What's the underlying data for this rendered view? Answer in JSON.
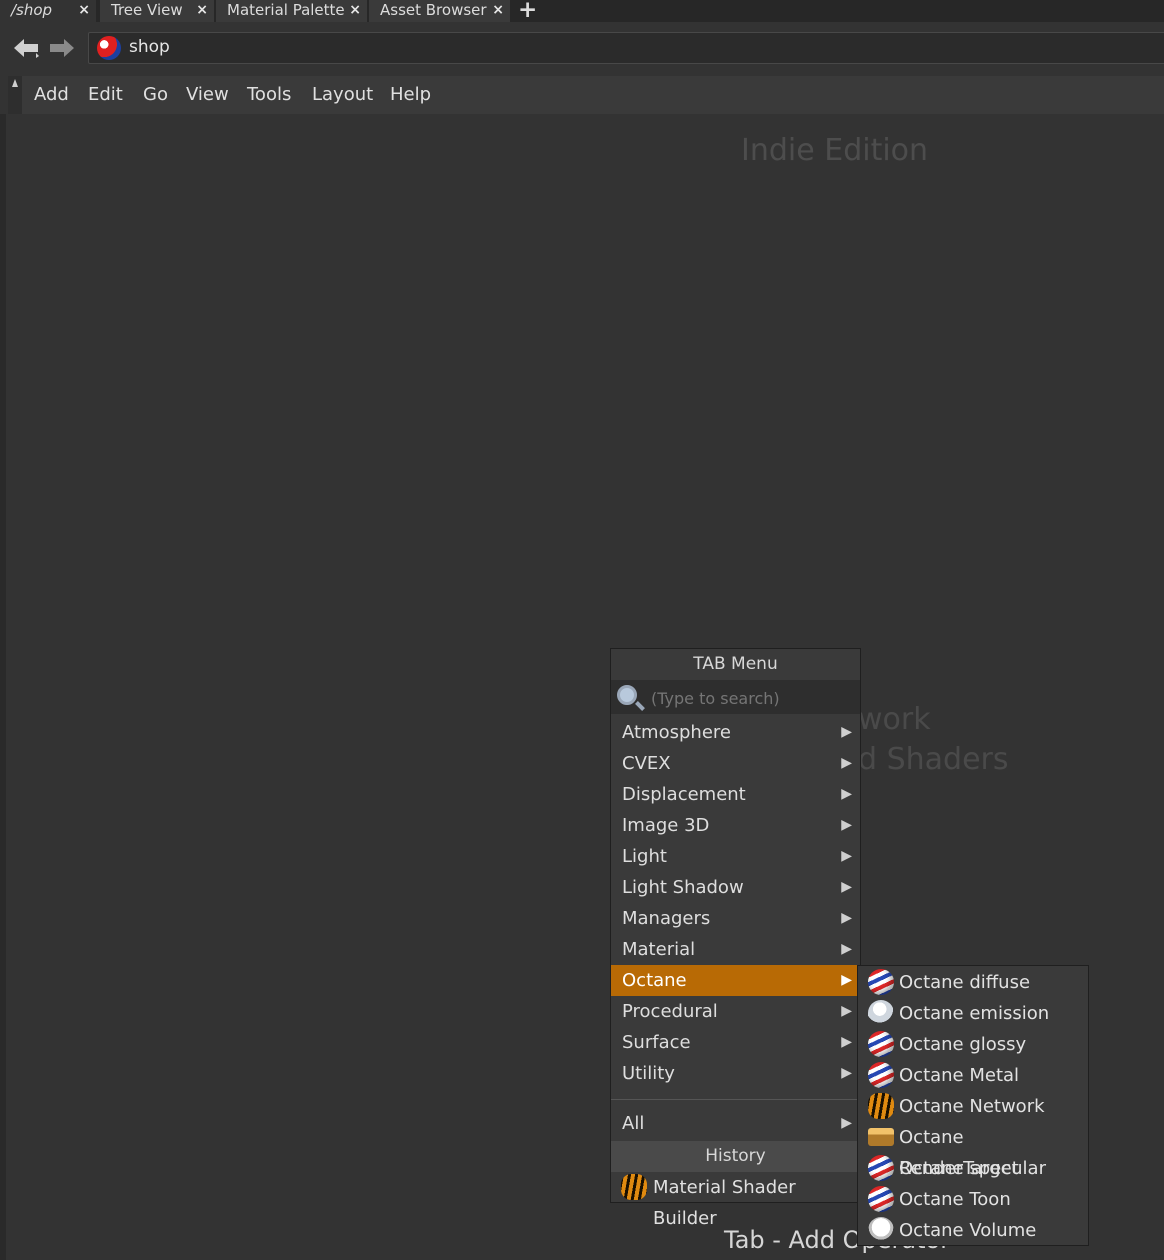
{
  "tabs": [
    {
      "label": "/shop",
      "active": true
    },
    {
      "label": "Tree View",
      "active": false
    },
    {
      "label": "Material Palette",
      "active": false
    },
    {
      "label": "Asset Browser",
      "active": false
    }
  ],
  "tab_close_glyph": "×",
  "tab_add_glyph": "+",
  "path": {
    "value": "shop",
    "icon": "shop-context-icon"
  },
  "menubar": [
    "Add",
    "Edit",
    "Go",
    "View",
    "Tools",
    "Layout",
    "Help"
  ],
  "canvas": {
    "edition": "Indie Edition",
    "bg_line1": "work",
    "bg_line2": "d Shaders",
    "footer": "Tab - Add Operator"
  },
  "tab_menu": {
    "title": "TAB Menu",
    "search_placeholder": "(Type to search)",
    "categories": [
      "Atmosphere",
      "CVEX",
      "Displacement",
      "Image 3D",
      "Light",
      "Light Shadow",
      "Managers",
      "Material",
      "Octane",
      "Procedural",
      "Surface",
      "Utility"
    ],
    "selected": "Octane",
    "all_label": "All",
    "history_title": "History",
    "history_items": [
      "Material Shader Builder"
    ],
    "arrow_glyph": "▶"
  },
  "octane_submenu": [
    {
      "label": "Octane diffuse",
      "icon": "ball"
    },
    {
      "label": "Octane emission",
      "icon": "bulb"
    },
    {
      "label": "Octane glossy",
      "icon": "ball"
    },
    {
      "label": "Octane Metal",
      "icon": "ball"
    },
    {
      "label": "Octane Network",
      "icon": "tiger"
    },
    {
      "label": "Octane RenderTarget",
      "icon": "box"
    },
    {
      "label": "Octane specular",
      "icon": "ball"
    },
    {
      "label": "Octane Toon",
      "icon": "ball"
    },
    {
      "label": "Octane Volume",
      "icon": "volume"
    }
  ],
  "colors": {
    "accent": "#b86a05",
    "background": "#333333",
    "menu_bg": "#3a3a3a"
  }
}
